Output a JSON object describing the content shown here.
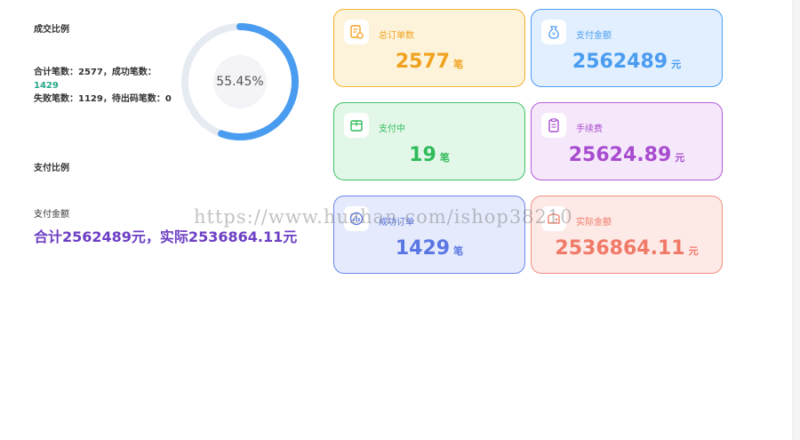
{
  "colors": {
    "donut_progress": "#4a9cf0",
    "donut_track": "#e6ebf2",
    "success_green": "#25a88a",
    "total_purple": "#6d3fc4"
  },
  "left": {
    "deal_ratio_title": "成交比例",
    "stats_line1": "合计笔数：2577，成功笔数：",
    "success_count": "1429",
    "stats_line2": "失败笔数：1129，待出码笔数：0",
    "pay_ratio_title": "支付比例",
    "pay_amount_title": "支付金额",
    "pay_amount_summary": "合计2562489元，实际2536864.11元"
  },
  "donut": {
    "percent_label": "55.45%",
    "fraction": 0.5545
  },
  "cards": [
    {
      "label": "总订单数",
      "value": "2577",
      "unit": "笔",
      "icon": "order-list-icon"
    },
    {
      "label": "支付金额",
      "value": "2562489",
      "unit": "元",
      "icon": "money-bag-icon"
    },
    {
      "label": "支付中",
      "value": "19",
      "unit": "笔",
      "icon": "box-icon"
    },
    {
      "label": "手续费",
      "value": "25624.89",
      "unit": "元",
      "icon": "clipboard-icon"
    },
    {
      "label": "成功订单",
      "value": "1429",
      "unit": "笔",
      "icon": "chart-icon"
    },
    {
      "label": "实际金额",
      "value": "2536864.11",
      "unit": "元",
      "icon": "wallet-icon"
    }
  ],
  "watermark": "https://www.huzhan.com/ishop38210"
}
